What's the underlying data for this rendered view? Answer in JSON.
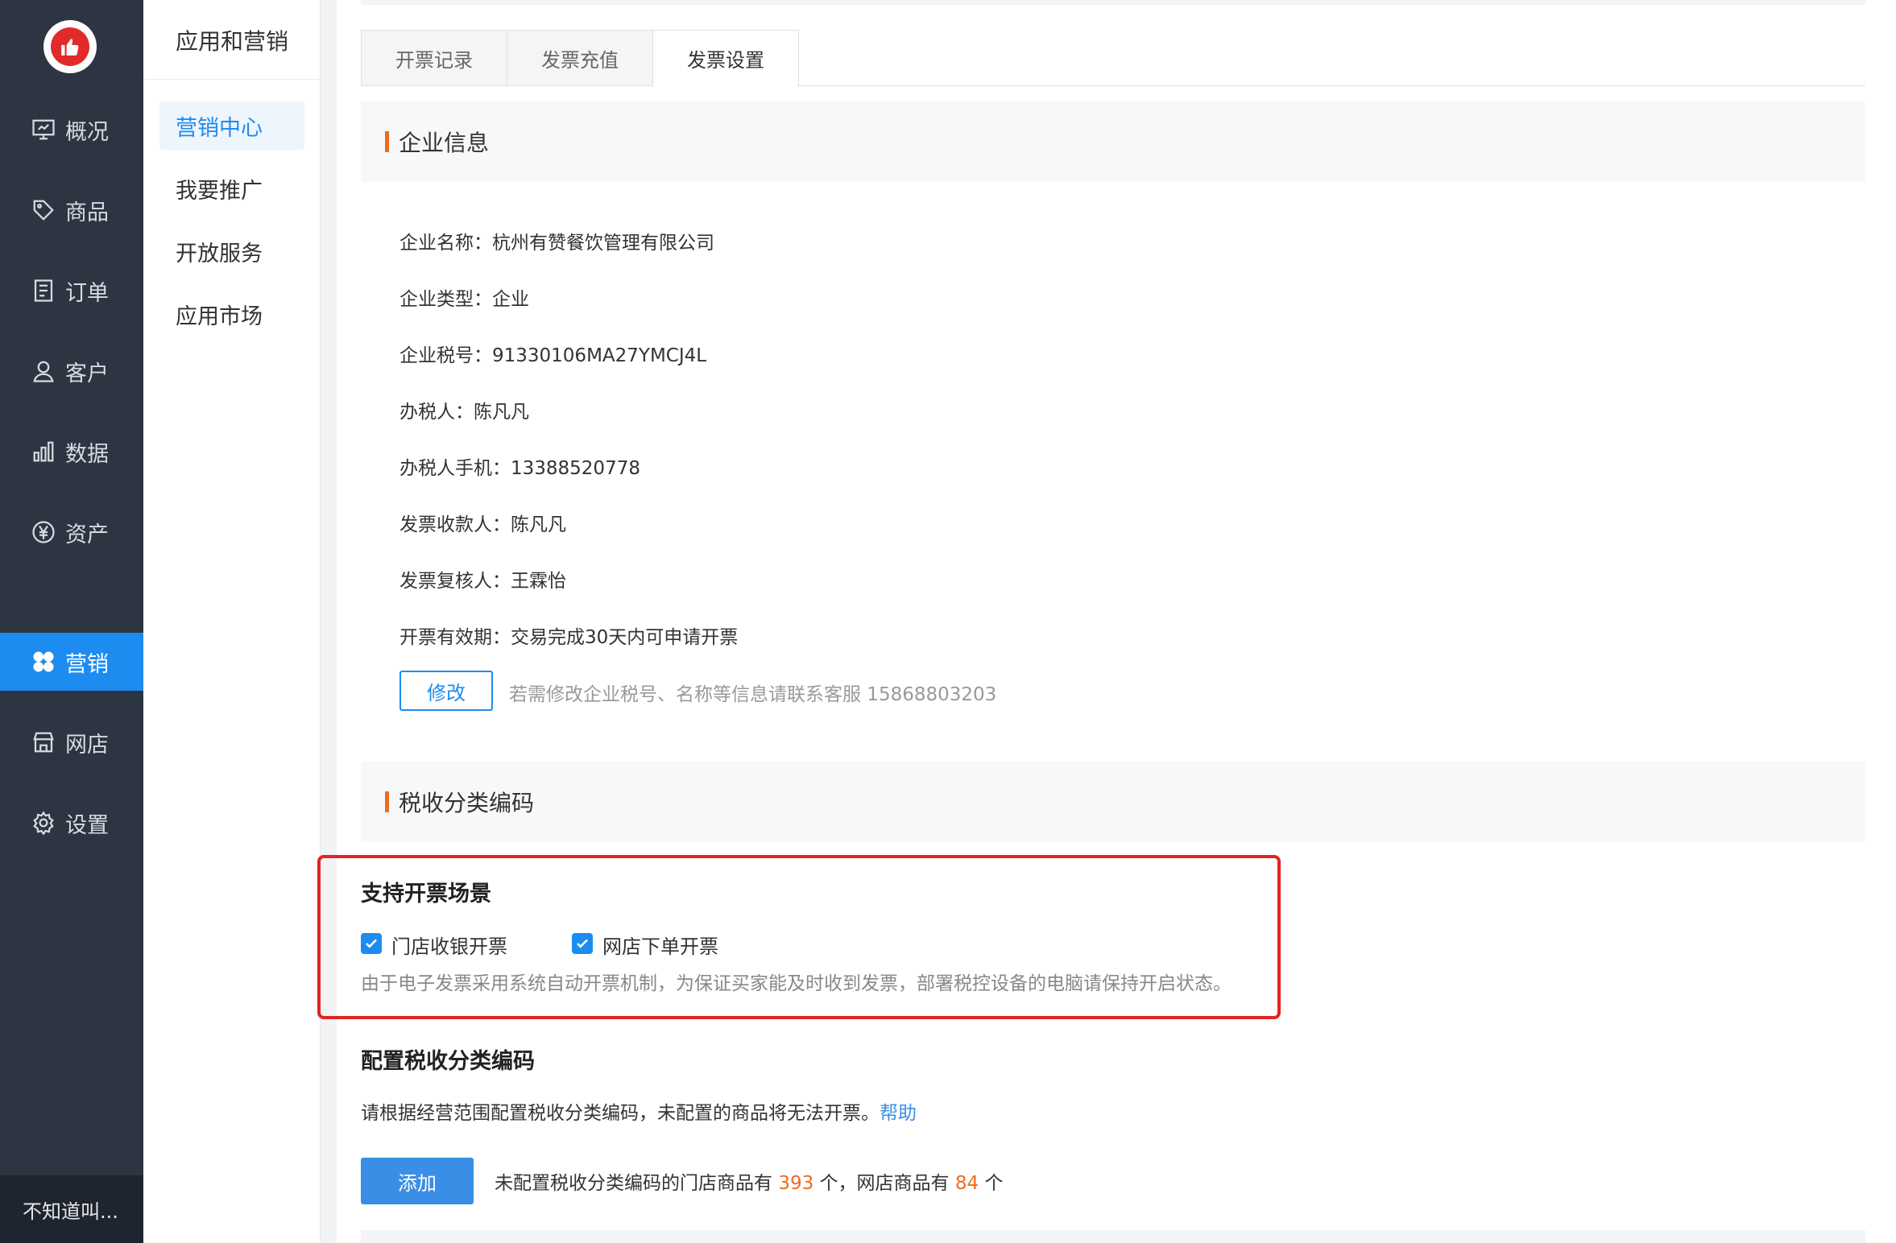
{
  "nav": {
    "items": [
      {
        "label": "概况",
        "icon": "presentation-icon"
      },
      {
        "label": "商品",
        "icon": "tag-icon"
      },
      {
        "label": "订单",
        "icon": "document-icon"
      },
      {
        "label": "客户",
        "icon": "user-icon"
      },
      {
        "label": "数据",
        "icon": "bar-chart-icon"
      },
      {
        "label": "资产",
        "icon": "yen-icon"
      },
      {
        "label": "营销",
        "icon": "clover-icon",
        "active": true
      },
      {
        "label": "网店",
        "icon": "shop-icon"
      },
      {
        "label": "设置",
        "icon": "gear-icon"
      }
    ],
    "footer_user": "不知道叫..."
  },
  "subnav": {
    "title": "应用和营销",
    "items": [
      {
        "label": "营销中心",
        "active": true
      },
      {
        "label": "我要推广"
      },
      {
        "label": "开放服务"
      },
      {
        "label": "应用市场"
      }
    ]
  },
  "tabs": [
    {
      "label": "开票记录"
    },
    {
      "label": "发票充值"
    },
    {
      "label": "发票设置",
      "active": true
    }
  ],
  "company": {
    "section_title": "企业信息",
    "rows": [
      "企业名称：杭州有赞餐饮管理有限公司",
      "企业类型：企业",
      "企业税号：91330106MA27YMCJ4L",
      "办税人：陈凡凡",
      "办税人手机：13388520778",
      "发票收款人：陈凡凡",
      "发票复核人：王霖怡",
      "开票有效期：交易完成30天内可申请开票"
    ],
    "edit_button": "修改",
    "hint": "若需修改企业税号、名称等信息请联系客服 15868803203"
  },
  "tax": {
    "section_title": "税收分类编码",
    "scene_title": "支持开票场景",
    "options": [
      {
        "label": "门店收银开票",
        "checked": true
      },
      {
        "label": "网店下单开票",
        "checked": true
      }
    ],
    "scene_desc": "由于电子发票采用系统自动开票机制，为保证买家能及时收到发票，部署税控设备的电脑请保持开启状态。",
    "config_title": "配置税收分类编码",
    "config_desc": "请根据经营范围配置税收分类编码，未配置的商品将无法开票。",
    "help_link": "帮助",
    "add_button": "添加",
    "stat_prefix": "未配置税收分类编码的门店商品有",
    "store_count": "393",
    "stat_mid": "个，网店商品有",
    "online_count": "84",
    "stat_suffix": "个"
  },
  "colors": {
    "nav_bg": "#2c3541",
    "accent": "#1d8cf0",
    "orange": "#f06b1f",
    "highlight": "#e32323"
  }
}
